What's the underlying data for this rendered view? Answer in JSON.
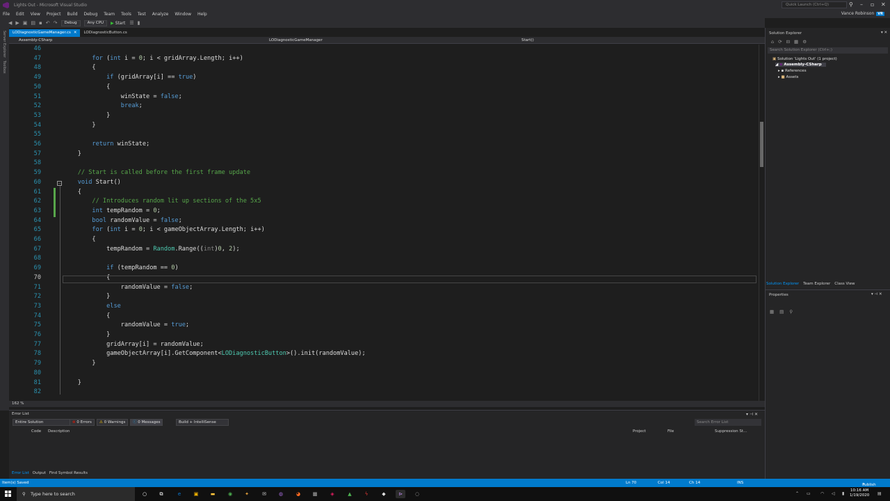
{
  "window": {
    "title": "Lights Out - Microsoft Visual Studio",
    "quick_launch_placeholder": "Quick Launch (Ctrl+Q)",
    "user_name": "Vance Robinson",
    "user_initials": "VR"
  },
  "menu": [
    "File",
    "Edit",
    "View",
    "Project",
    "Build",
    "Debug",
    "Team",
    "Tools",
    "Test",
    "Analyze",
    "Window",
    "Help"
  ],
  "toolbar": {
    "config": "Debug",
    "platform": "Any CPU",
    "start_label": "Start"
  },
  "left_strip": [
    "Server Explorer",
    "Toolbox"
  ],
  "tabs": [
    {
      "label": "LODiagnosticGameManager.cs",
      "active": true
    },
    {
      "label": "LODiagnosticButton.cs",
      "active": false
    }
  ],
  "navbar": {
    "project": "Assembly-CSharp",
    "class": "LODiagnosticGameManager",
    "member": "Start()"
  },
  "editor": {
    "zoom": "162 %",
    "lines": [
      {
        "n": "46",
        "t": ""
      },
      {
        "n": "47",
        "t": "        <span class=\"kw\">for</span> (<span class=\"kw\">int</span> i = <span class=\"nu\">0</span>; i &lt; gridArray.Length; i++)"
      },
      {
        "n": "48",
        "t": "        {"
      },
      {
        "n": "49",
        "t": "            <span class=\"kw\">if</span> (gridArray[i] == <span class=\"kw\">true</span>)"
      },
      {
        "n": "50",
        "t": "            {"
      },
      {
        "n": "51",
        "t": "                winState = <span class=\"kw\">false</span>;"
      },
      {
        "n": "52",
        "t": "                <span class=\"kw\">break</span>;"
      },
      {
        "n": "53",
        "t": "            }"
      },
      {
        "n": "54",
        "t": "        }"
      },
      {
        "n": "55",
        "t": ""
      },
      {
        "n": "56",
        "t": "        <span class=\"kw\">return</span> winState;"
      },
      {
        "n": "57",
        "t": "    }"
      },
      {
        "n": "58",
        "t": ""
      },
      {
        "n": "59",
        "t": "    <span class=\"cm\">// Start is called before the first frame update</span>"
      },
      {
        "n": "60",
        "t": "    <span class=\"kw\">void</span> Start()"
      },
      {
        "n": "61",
        "t": "    {"
      },
      {
        "n": "62",
        "t": "        <span class=\"cm\">// Introduces random lit up sections of the 5x5</span>"
      },
      {
        "n": "63",
        "t": "        <span class=\"kw\">int</span> tempRandom = <span class=\"nu\">0</span>;"
      },
      {
        "n": "64",
        "t": "        <span class=\"kw\">bool</span> randomValue = <span class=\"kw\">false</span>;"
      },
      {
        "n": "65",
        "t": "        <span class=\"kw\">for</span> (<span class=\"kw\">int</span> i = <span class=\"nu\">0</span>; i &lt; gameObjectArray.Length; i++)"
      },
      {
        "n": "66",
        "t": "        {"
      },
      {
        "n": "67",
        "t": "            tempRandom = <span class=\"ty\">Random</span>.Range((<span class=\"cast\">int</span>)<span class=\"nu\">0</span>, <span class=\"nu\">2</span>);"
      },
      {
        "n": "68",
        "t": ""
      },
      {
        "n": "69",
        "t": "            <span class=\"kw\">if</span> (tempRandom == <span class=\"nu\">0</span>)"
      },
      {
        "n": "70",
        "t": "            {",
        "current": true
      },
      {
        "n": "71",
        "t": "                randomValue = <span class=\"kw\">false</span>;"
      },
      {
        "n": "72",
        "t": "            }"
      },
      {
        "n": "73",
        "t": "            <span class=\"kw\">else</span>"
      },
      {
        "n": "74",
        "t": "            {"
      },
      {
        "n": "75",
        "t": "                randomValue = <span class=\"kw\">true</span>;"
      },
      {
        "n": "76",
        "t": "            }"
      },
      {
        "n": "77",
        "t": "            gridArray[i] = randomValue;"
      },
      {
        "n": "78",
        "t": "            gameObjectArray[i].GetComponent&lt;<span class=\"ty\">LODiagnosticButton</span>&gt;().init(randomValue);"
      },
      {
        "n": "79",
        "t": "        }"
      },
      {
        "n": "80",
        "t": ""
      },
      {
        "n": "81",
        "t": "    }"
      },
      {
        "n": "82",
        "t": ""
      }
    ]
  },
  "solution_explorer": {
    "title": "Solution Explorer",
    "search_placeholder": "Search Solution Explorer (Ctrl+;)",
    "items": [
      {
        "label": "Solution 'Lights Out' (1 project)",
        "depth": 0
      },
      {
        "label": "Assembly-CSharp",
        "depth": 1,
        "selected": true
      },
      {
        "label": "References",
        "depth": 2
      },
      {
        "label": "Assets",
        "depth": 2
      }
    ],
    "tabs": [
      "Solution Explorer",
      "Team Explorer",
      "Class View"
    ]
  },
  "properties": {
    "title": "Properties"
  },
  "error_list": {
    "title": "Error List",
    "scope": "Entire Solution",
    "errors": "0 Errors",
    "warnings": "0 Warnings",
    "messages": "0 Messages",
    "build_filter": "Build + IntelliSense",
    "search_placeholder": "Search Error List",
    "columns": [
      "Code",
      "Description",
      "Project",
      "File",
      "Suppression St..."
    ],
    "bottom_tabs": [
      "Error List",
      "Output",
      "Find Symbol Results"
    ]
  },
  "statusbar": {
    "left": "Item(s) Saved",
    "ln": "Ln 70",
    "col": "Col 14",
    "ch": "Ch 14",
    "mode": "INS",
    "publish": "Publish"
  },
  "taskbar": {
    "search_placeholder": "Type here to search",
    "time": "10:16 AM",
    "date": "1/19/2020"
  }
}
